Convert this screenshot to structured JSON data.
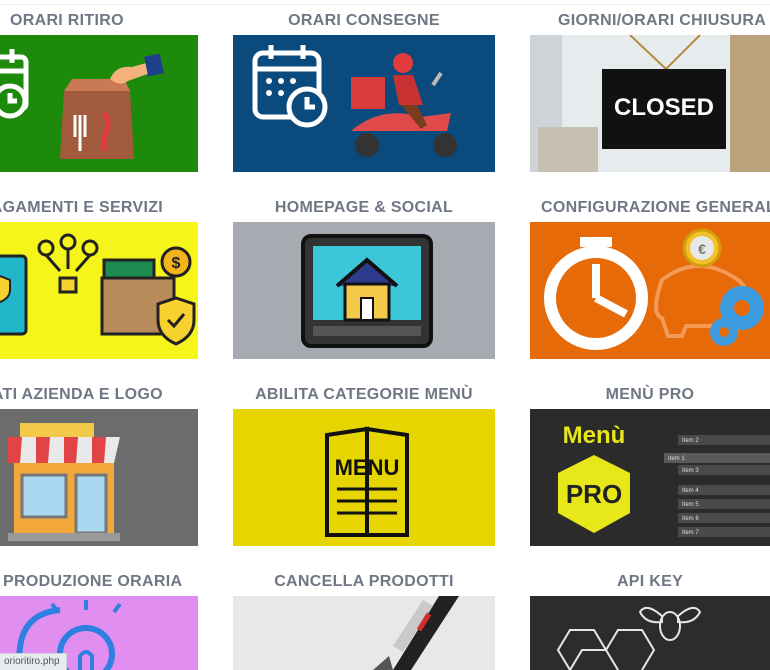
{
  "tiles": [
    {
      "label": "ORARI RITIRO",
      "bg": "#1e8a0b"
    },
    {
      "label": "ORARI CONSEGNE",
      "bg": "#0b4a7c"
    },
    {
      "label": "GIORNI/ORARI CHIUSURA",
      "bg": "#dfe4e6",
      "sign_text": "CLOSED"
    },
    {
      "label": "PAGAMENTI E SERVIZI",
      "bg": "#f5f51b"
    },
    {
      "label": "HOMEPAGE & SOCIAL",
      "bg": "#a6aab1"
    },
    {
      "label": "CONFIGURAZIONE GENERALE",
      "bg": "#e76a08"
    },
    {
      "label": "DATI AZIENDA E LOGO",
      "bg": "#6c6c6c"
    },
    {
      "label": "ABILITA CATEGORIE MENÙ",
      "bg": "#e7d501",
      "menu_text": "MENU"
    },
    {
      "label": "MENÙ PRO",
      "bg": "#2b2b2b",
      "title_text": "Menù",
      "badge_text": "PRO",
      "items": [
        "Item 2",
        "Item 1",
        "Item 3",
        "Item 4",
        "Item 5",
        "Item 6",
        "Item 7"
      ]
    },
    {
      "label": "PRODUZIONE ORARIA",
      "bg": "#e08ff1"
    },
    {
      "label": "CANCELLA PRODOTTI",
      "bg": "#eaeaea"
    },
    {
      "label": "API KEY",
      "bg": "#2c2c2c"
    }
  ],
  "status_link": "orioritiro.php"
}
